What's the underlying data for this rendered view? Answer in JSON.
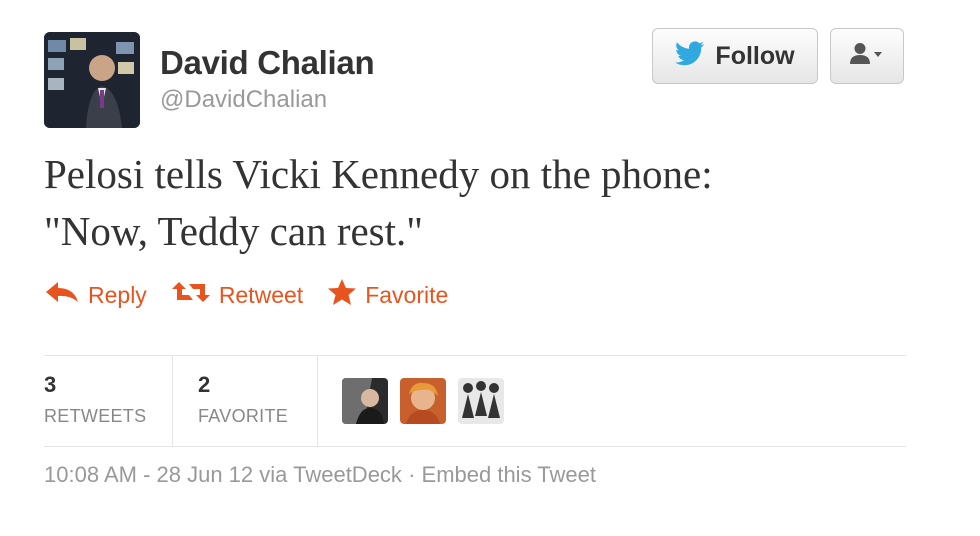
{
  "user": {
    "name": "David Chalian",
    "handle": "@DavidChalian"
  },
  "header": {
    "follow_label": "Follow",
    "bird_icon": "twitter-bird-icon",
    "user_menu_icon": "user-dropdown-icon"
  },
  "tweet": {
    "lines": [
      "Pelosi tells Vicki Kennedy on the phone:",
      "\"Now, Teddy can rest.\""
    ]
  },
  "actions": {
    "reply": "Reply",
    "retweet": "Retweet",
    "favorite": "Favorite",
    "color": "#e8541e"
  },
  "stats": {
    "retweets_count": "3",
    "retweets_label": "RETWEETS",
    "favorites_count": "2",
    "favorites_label": "FAVORITE"
  },
  "meta": {
    "timestamp": "10:08 AM - 28 Jun 12",
    "via": "via",
    "client": "TweetDeck",
    "separator": "·",
    "embed": "Embed this Tweet"
  }
}
